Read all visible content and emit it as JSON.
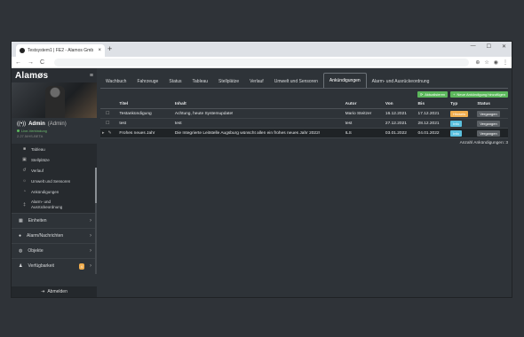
{
  "browser": {
    "tab_title": "Testsystem1 | FE2 - Alamos Gmb",
    "tab_close": "×",
    "new_tab": "+",
    "controls": {
      "minimize": "—",
      "maximize": "☐",
      "close": "✕"
    },
    "nav": {
      "back": "←",
      "forward": "→",
      "reload": "C"
    },
    "actions": {
      "zoom": "⊕",
      "star": "☆",
      "profile": "◉",
      "menu": "⋮"
    }
  },
  "sidebar": {
    "logo": "Alamøs",
    "menu_icon": "≡",
    "user": {
      "name": "Admin",
      "role": "(Admin)",
      "status": "Live-Verbindung",
      "version": "2.27.5/HS-BETA"
    },
    "subitems": [
      {
        "label": "Tableau",
        "icon": "■"
      },
      {
        "label": "Stellplätze",
        "icon": "▣"
      },
      {
        "label": "Verlauf",
        "icon": "↺"
      },
      {
        "label": "Umwelt und Sensoren",
        "icon": "☼"
      },
      {
        "label": "Ankündigungen",
        "icon": "◔"
      },
      {
        "label": "Alarm- und Ausrückeordnung",
        "icon": "‡"
      }
    ],
    "nav": [
      {
        "label": "Einheiten",
        "icon": "▦",
        "chevron": "›"
      },
      {
        "label": "Alarm/Nachrichten",
        "icon": "●",
        "chevron": "›"
      },
      {
        "label": "Objekte",
        "icon": "◍",
        "chevron": "›"
      },
      {
        "label": "Verfügbarkeit",
        "icon": "♟",
        "chevron": "›",
        "badge": "4"
      }
    ],
    "logout": "Abmelden",
    "logout_icon": "⇥"
  },
  "main": {
    "tabs": [
      "Wachbuch",
      "Fahrzeuge",
      "Status",
      "Tableau",
      "Stellplätze",
      "Verlauf",
      "Umwelt und Sensoren",
      "Ankündigungen",
      "Alarm- und Ausrückeordnung"
    ],
    "active_tab": "Ankündigungen",
    "buttons": {
      "refresh": "Aktualisieren",
      "new": "Neue Ankündigung hinzufügen"
    },
    "columns": [
      "",
      "Titel",
      "Inhalt",
      "Autor",
      "Von",
      "Bis",
      "Typ",
      "Status"
    ],
    "rows": [
      {
        "icons": [
          "",
          "☐"
        ],
        "title": "Testankündigung",
        "content": "Achtung, heute Systemupdate!",
        "author": "Mario Steitzer",
        "from": "16.12.2021",
        "to": "17.12.2021",
        "type": "Hinweis",
        "status": "Vergangen"
      },
      {
        "icons": [
          "",
          "☐"
        ],
        "title": "test",
        "content": "test",
        "author": "test",
        "from": "27.12.2021",
        "to": "28.12.2021",
        "type": "Info",
        "status": "Vergangen"
      },
      {
        "icons": [
          "▸",
          "✎"
        ],
        "title": "Frohes neues Jahr",
        "content": "Die Integrierte Leitstelle Augsburg wünscht allen ein frohes neues Jahr 2022!",
        "author": "ILS",
        "from": "03.01.2022",
        "to": "04.01.2022",
        "type": "Info",
        "status": "Vergangen"
      }
    ],
    "summary_label": "Anzahl Ankündigungen:",
    "summary_count": "3"
  },
  "colors": {
    "green": "#5cb85c",
    "orange": "#f0ad4e",
    "info": "#5bc0de",
    "sidebar": "#2e3338"
  }
}
